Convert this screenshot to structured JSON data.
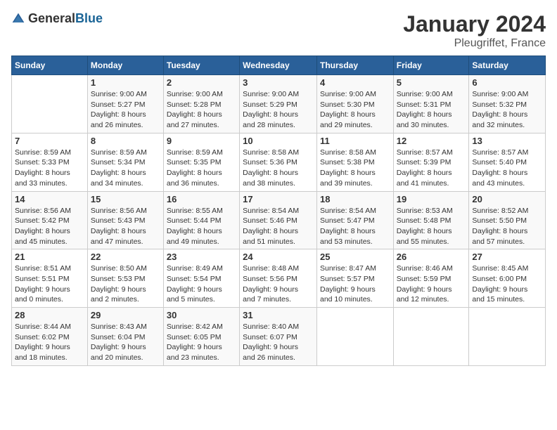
{
  "logo": {
    "text_general": "General",
    "text_blue": "Blue"
  },
  "header": {
    "title": "January 2024",
    "subtitle": "Pleugriffet, France"
  },
  "weekdays": [
    "Sunday",
    "Monday",
    "Tuesday",
    "Wednesday",
    "Thursday",
    "Friday",
    "Saturday"
  ],
  "weeks": [
    [
      {
        "day": "",
        "info": ""
      },
      {
        "day": "1",
        "info": "Sunrise: 9:00 AM\nSunset: 5:27 PM\nDaylight: 8 hours\nand 26 minutes."
      },
      {
        "day": "2",
        "info": "Sunrise: 9:00 AM\nSunset: 5:28 PM\nDaylight: 8 hours\nand 27 minutes."
      },
      {
        "day": "3",
        "info": "Sunrise: 9:00 AM\nSunset: 5:29 PM\nDaylight: 8 hours\nand 28 minutes."
      },
      {
        "day": "4",
        "info": "Sunrise: 9:00 AM\nSunset: 5:30 PM\nDaylight: 8 hours\nand 29 minutes."
      },
      {
        "day": "5",
        "info": "Sunrise: 9:00 AM\nSunset: 5:31 PM\nDaylight: 8 hours\nand 30 minutes."
      },
      {
        "day": "6",
        "info": "Sunrise: 9:00 AM\nSunset: 5:32 PM\nDaylight: 8 hours\nand 32 minutes."
      }
    ],
    [
      {
        "day": "7",
        "info": "Sunrise: 8:59 AM\nSunset: 5:33 PM\nDaylight: 8 hours\nand 33 minutes."
      },
      {
        "day": "8",
        "info": "Sunrise: 8:59 AM\nSunset: 5:34 PM\nDaylight: 8 hours\nand 34 minutes."
      },
      {
        "day": "9",
        "info": "Sunrise: 8:59 AM\nSunset: 5:35 PM\nDaylight: 8 hours\nand 36 minutes."
      },
      {
        "day": "10",
        "info": "Sunrise: 8:58 AM\nSunset: 5:36 PM\nDaylight: 8 hours\nand 38 minutes."
      },
      {
        "day": "11",
        "info": "Sunrise: 8:58 AM\nSunset: 5:38 PM\nDaylight: 8 hours\nand 39 minutes."
      },
      {
        "day": "12",
        "info": "Sunrise: 8:57 AM\nSunset: 5:39 PM\nDaylight: 8 hours\nand 41 minutes."
      },
      {
        "day": "13",
        "info": "Sunrise: 8:57 AM\nSunset: 5:40 PM\nDaylight: 8 hours\nand 43 minutes."
      }
    ],
    [
      {
        "day": "14",
        "info": "Sunrise: 8:56 AM\nSunset: 5:42 PM\nDaylight: 8 hours\nand 45 minutes."
      },
      {
        "day": "15",
        "info": "Sunrise: 8:56 AM\nSunset: 5:43 PM\nDaylight: 8 hours\nand 47 minutes."
      },
      {
        "day": "16",
        "info": "Sunrise: 8:55 AM\nSunset: 5:44 PM\nDaylight: 8 hours\nand 49 minutes."
      },
      {
        "day": "17",
        "info": "Sunrise: 8:54 AM\nSunset: 5:46 PM\nDaylight: 8 hours\nand 51 minutes."
      },
      {
        "day": "18",
        "info": "Sunrise: 8:54 AM\nSunset: 5:47 PM\nDaylight: 8 hours\nand 53 minutes."
      },
      {
        "day": "19",
        "info": "Sunrise: 8:53 AM\nSunset: 5:48 PM\nDaylight: 8 hours\nand 55 minutes."
      },
      {
        "day": "20",
        "info": "Sunrise: 8:52 AM\nSunset: 5:50 PM\nDaylight: 8 hours\nand 57 minutes."
      }
    ],
    [
      {
        "day": "21",
        "info": "Sunrise: 8:51 AM\nSunset: 5:51 PM\nDaylight: 9 hours\nand 0 minutes."
      },
      {
        "day": "22",
        "info": "Sunrise: 8:50 AM\nSunset: 5:53 PM\nDaylight: 9 hours\nand 2 minutes."
      },
      {
        "day": "23",
        "info": "Sunrise: 8:49 AM\nSunset: 5:54 PM\nDaylight: 9 hours\nand 5 minutes."
      },
      {
        "day": "24",
        "info": "Sunrise: 8:48 AM\nSunset: 5:56 PM\nDaylight: 9 hours\nand 7 minutes."
      },
      {
        "day": "25",
        "info": "Sunrise: 8:47 AM\nSunset: 5:57 PM\nDaylight: 9 hours\nand 10 minutes."
      },
      {
        "day": "26",
        "info": "Sunrise: 8:46 AM\nSunset: 5:59 PM\nDaylight: 9 hours\nand 12 minutes."
      },
      {
        "day": "27",
        "info": "Sunrise: 8:45 AM\nSunset: 6:00 PM\nDaylight: 9 hours\nand 15 minutes."
      }
    ],
    [
      {
        "day": "28",
        "info": "Sunrise: 8:44 AM\nSunset: 6:02 PM\nDaylight: 9 hours\nand 18 minutes."
      },
      {
        "day": "29",
        "info": "Sunrise: 8:43 AM\nSunset: 6:04 PM\nDaylight: 9 hours\nand 20 minutes."
      },
      {
        "day": "30",
        "info": "Sunrise: 8:42 AM\nSunset: 6:05 PM\nDaylight: 9 hours\nand 23 minutes."
      },
      {
        "day": "31",
        "info": "Sunrise: 8:40 AM\nSunset: 6:07 PM\nDaylight: 9 hours\nand 26 minutes."
      },
      {
        "day": "",
        "info": ""
      },
      {
        "day": "",
        "info": ""
      },
      {
        "day": "",
        "info": ""
      }
    ]
  ]
}
